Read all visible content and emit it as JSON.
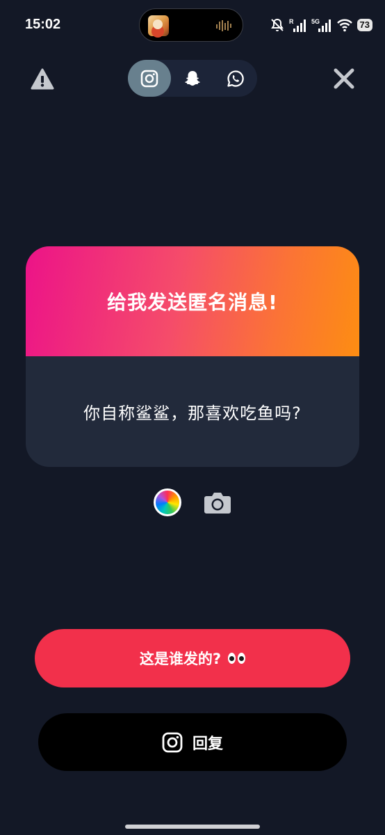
{
  "status_bar": {
    "time": "15:02",
    "network_label": "5G",
    "signal_label": "R",
    "battery": "73"
  },
  "top_bar": {
    "platforms": [
      {
        "id": "instagram",
        "icon": "instagram-icon",
        "active": true
      },
      {
        "id": "snapchat",
        "icon": "snapchat-icon",
        "active": false
      },
      {
        "id": "whatsapp",
        "icon": "whatsapp-icon",
        "active": false
      }
    ],
    "left_icon": "warning-icon",
    "right_icon": "close-icon"
  },
  "card": {
    "title": "给我发送匿名消息!",
    "question": "你自称鲨鲨，那喜欢吃鱼吗?"
  },
  "tools": {
    "color_icon": "color-wheel-icon",
    "camera_icon": "camera-icon"
  },
  "actions": {
    "who_sent_label": "这是谁发的?",
    "reply_label": "回复"
  },
  "colors": {
    "background": "#131826",
    "card_gradient_start": "#ec1388",
    "card_gradient_end": "#fd8d12",
    "card_body": "#222a3b",
    "primary_button": "#f2304b",
    "secondary_button": "#000000",
    "active_tab": "#68808e"
  }
}
